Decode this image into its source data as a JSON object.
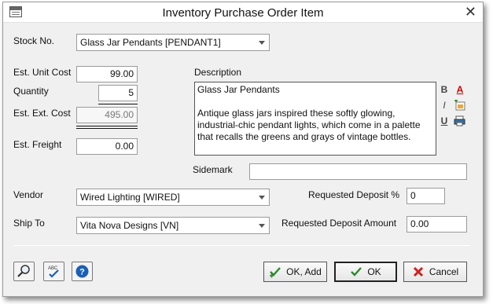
{
  "window": {
    "title": "Inventory Purchase Order Item"
  },
  "form": {
    "stock_no_label": "Stock No.",
    "stock_no_value": "Glass Jar Pendants [PENDANT1]",
    "unit_cost_label": "Est. Unit Cost",
    "unit_cost_value": "99.00",
    "quantity_label": "Quantity",
    "quantity_value": "5",
    "ext_cost_label": "Est. Ext. Cost",
    "ext_cost_value": "495.00",
    "freight_label": "Est. Freight",
    "freight_value": "0.00",
    "description_label": "Description",
    "description_title": "Glass Jar Pendants",
    "description_body": "Antique glass jars inspired these softly glowing, industrial-chic pendant lights, which come in a palette that recalls the greens and grays of vintage bottles.",
    "sidemark_label": "Sidemark",
    "sidemark_value": "",
    "vendor_label": "Vendor",
    "vendor_value": "Wired Lighting [WIRED]",
    "ship_to_label": "Ship To",
    "ship_to_value": "Vita Nova Designs [VN]",
    "deposit_pct_label": "Requested Deposit %",
    "deposit_pct_value": "0",
    "deposit_amt_label": "Requested Deposit Amount",
    "deposit_amt_value": "0.00"
  },
  "formatting": {
    "bold": "B",
    "italic": "I",
    "underline": "U",
    "font_color": "A"
  },
  "buttons": {
    "ok_add_label": "OK, Add",
    "ok_label": "OK",
    "cancel_label": "Cancel"
  },
  "colors": {
    "window_bg": "#f0f0f0",
    "ok_check": "#2a8a2a",
    "cancel_x": "#d02020",
    "help": "#1a5fb4"
  }
}
